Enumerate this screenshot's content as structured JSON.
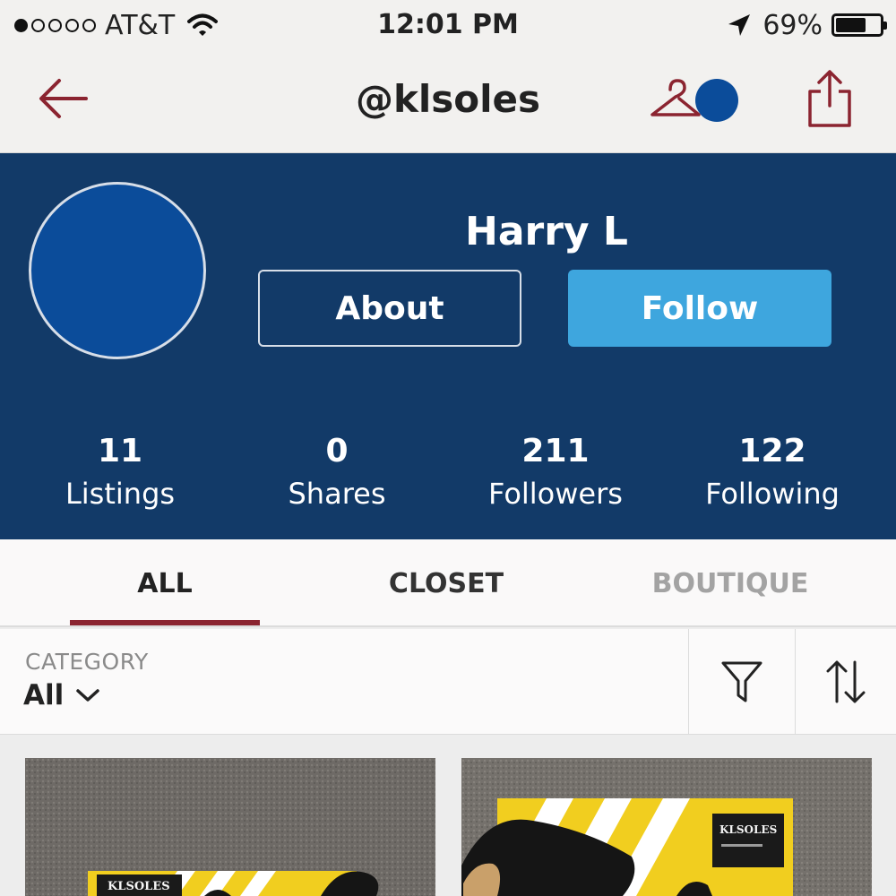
{
  "status_bar": {
    "carrier": "AT&T",
    "time": "12:01 PM",
    "battery": "69%",
    "signal_strength": 1,
    "battery_level": 0.69
  },
  "nav": {
    "title": "@klsoles"
  },
  "profile": {
    "name": "Harry L",
    "about_label": "About",
    "follow_label": "Follow",
    "stats": [
      {
        "count": "11",
        "label": "Listings"
      },
      {
        "count": "0",
        "label": "Shares"
      },
      {
        "count": "211",
        "label": "Followers"
      },
      {
        "count": "122",
        "label": "Following"
      }
    ]
  },
  "tabs": [
    {
      "label": "ALL",
      "active": true
    },
    {
      "label": "CLOSET",
      "active": false
    },
    {
      "label": "BOUTIQUE",
      "active": false
    }
  ],
  "filter": {
    "category_label": "CATEGORY",
    "category_value": "All"
  },
  "listings": [
    {
      "brand_text": "KLSOLES"
    },
    {
      "brand_text": "KLSOLES"
    }
  ],
  "colors": {
    "brand_red": "#8b2430",
    "profile_bg": "#123a68",
    "avatar_blue": "#0b4c9a",
    "follow_blue": "#3ea6de"
  },
  "icons": {
    "back": "arrow-left-icon",
    "closet": "hanger-icon",
    "share": "share-icon",
    "filter": "funnel-icon",
    "sort": "sort-arrows-icon",
    "category_dropdown": "chevron-down-icon",
    "wifi": "wifi-icon",
    "location": "location-arrow-icon"
  }
}
